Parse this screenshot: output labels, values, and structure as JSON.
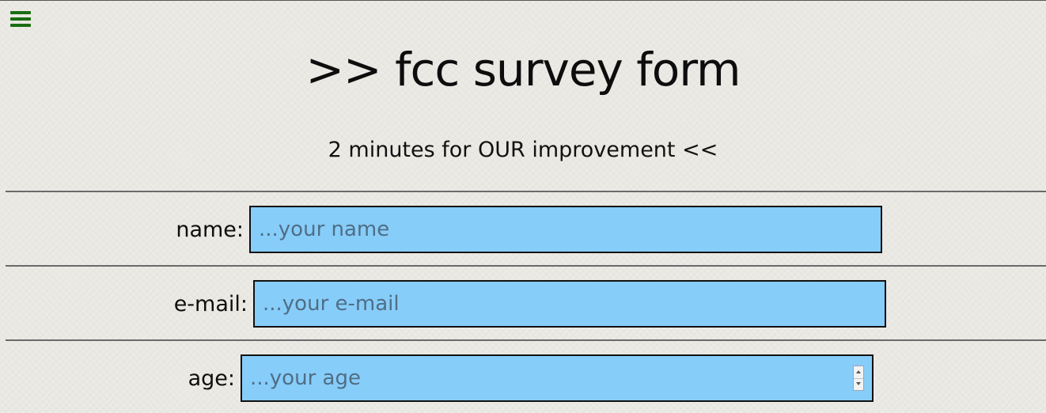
{
  "header": {
    "title": ">> fcc survey form",
    "subtitle": "2 minutes for OUR improvement <<"
  },
  "menu": {
    "icon": "hamburger-menu-icon",
    "color": "#1a6d12"
  },
  "form": {
    "name": {
      "label": "name:",
      "value": "",
      "placeholder": "...your name"
    },
    "email": {
      "label": "e-mail:",
      "value": "",
      "placeholder": "...your e-mail"
    },
    "age": {
      "label": "age:",
      "value": "",
      "placeholder": "...your age"
    }
  },
  "colors": {
    "input_background": "#87cdfa",
    "page_background": "#ebeae5",
    "divider": "#6a6a6a"
  }
}
